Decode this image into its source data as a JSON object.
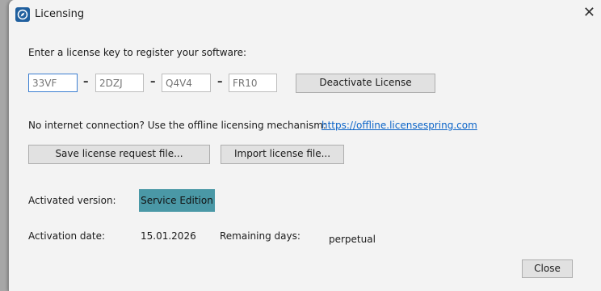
{
  "window": {
    "title": "Licensing",
    "close_glyph": "✕"
  },
  "prompt": "Enter a license key to register your software:",
  "license_key": {
    "parts": [
      {
        "placeholder": "33VF"
      },
      {
        "placeholder": "2DZJ"
      },
      {
        "placeholder": "Q4V4"
      },
      {
        "placeholder": "FR10"
      }
    ],
    "separator": "–"
  },
  "buttons": {
    "deactivate": "Deactivate License",
    "save_request": "Save license request file...",
    "import_license": "Import license file...",
    "close": "Close"
  },
  "offline": {
    "text": "No internet connection? Use the offline licensing mechanism:",
    "link": "https://offline.licensespring.com"
  },
  "activation": {
    "version_label": "Activated version:",
    "version_value": "Service Edition",
    "date_label": "Activation date:",
    "date_value": "15.01.2026",
    "remaining_label": "Remaining days:",
    "remaining_value": "perpetual"
  },
  "colors": {
    "accent": "#4a98a6",
    "link": "#0b64c8",
    "icon": "#1f5f9e"
  },
  "icons": {
    "app": "license-compass-icon",
    "close": "close-icon"
  }
}
